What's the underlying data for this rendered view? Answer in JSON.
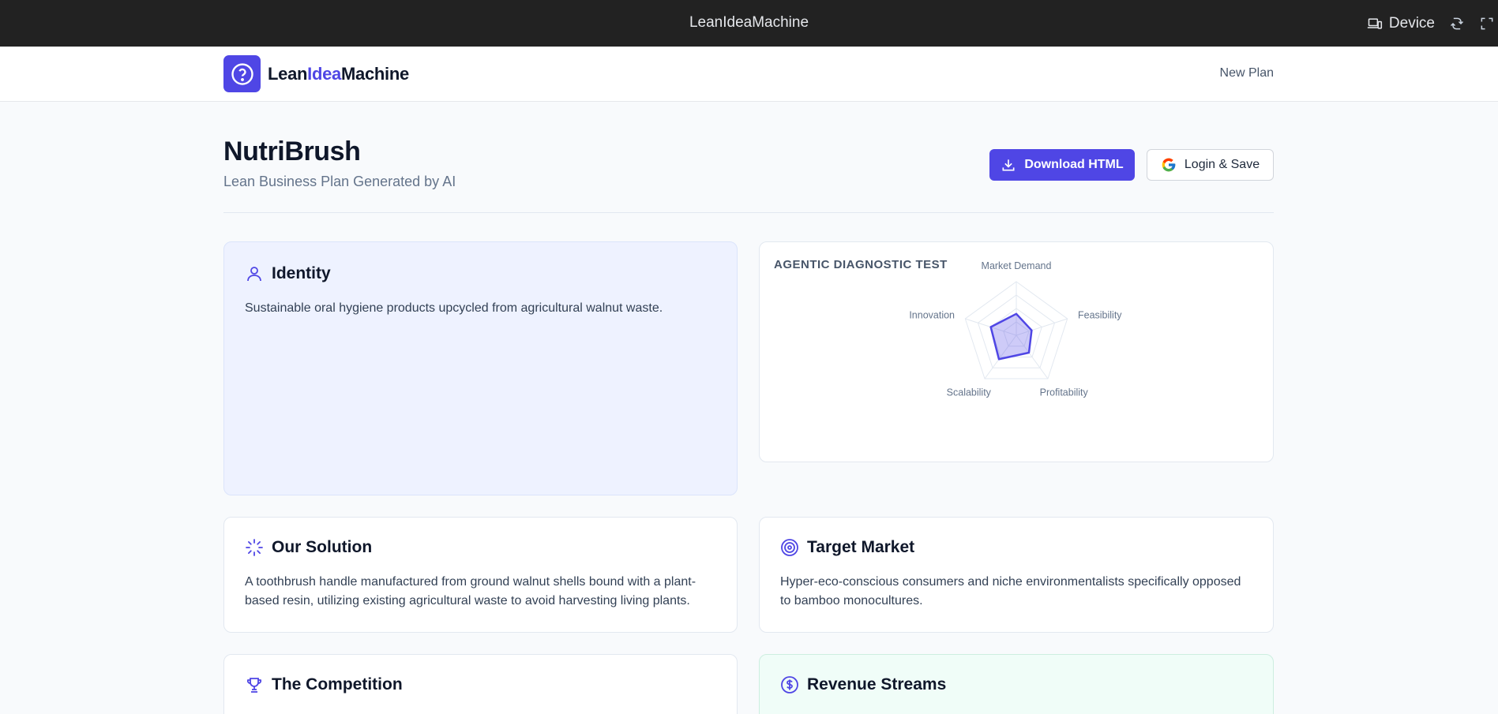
{
  "window": {
    "title": "LeanIdeaMachine",
    "device_label": "Device"
  },
  "nav": {
    "brand_part1": "Lean",
    "brand_part2": "Idea",
    "brand_part3": "Machine",
    "new_plan": "New Plan"
  },
  "header": {
    "title": "NutriBrush",
    "subtitle": "Lean Business Plan Generated by AI",
    "download_label": "Download HTML",
    "login_label": "Login & Save"
  },
  "identity": {
    "title": "Identity",
    "text": "Sustainable oral hygiene products upcycled from agricultural walnut waste."
  },
  "diagnostic": {
    "title": "AGENTIC DIAGNOSTIC TEST"
  },
  "chart_data": {
    "type": "radar",
    "axes": [
      "Market Demand",
      "Feasibility",
      "Profitability",
      "Scalability",
      "Innovation"
    ],
    "series": [
      {
        "values": [
          0.4,
          0.3,
          0.4,
          0.55,
          0.5
        ]
      }
    ],
    "range": [
      0,
      1
    ],
    "rings": 4,
    "color": "#4f46e5"
  },
  "solution": {
    "title": "Our Solution",
    "text": "A toothbrush handle manufactured from ground walnut shells bound with a plant-based resin, utilizing existing agricultural waste to avoid harvesting living plants."
  },
  "target": {
    "title": "Target Market",
    "text": "Hyper-eco-conscious consumers and niche environmentalists specifically opposed to bamboo monocultures."
  },
  "competition": {
    "title": "The Competition"
  },
  "revenue": {
    "title": "Revenue Streams"
  },
  "colors": {
    "accent": "#4f46e5",
    "topbar": "#222222",
    "identity_bg": "#eef2ff",
    "revenue_bg": "#f0fdf8"
  }
}
